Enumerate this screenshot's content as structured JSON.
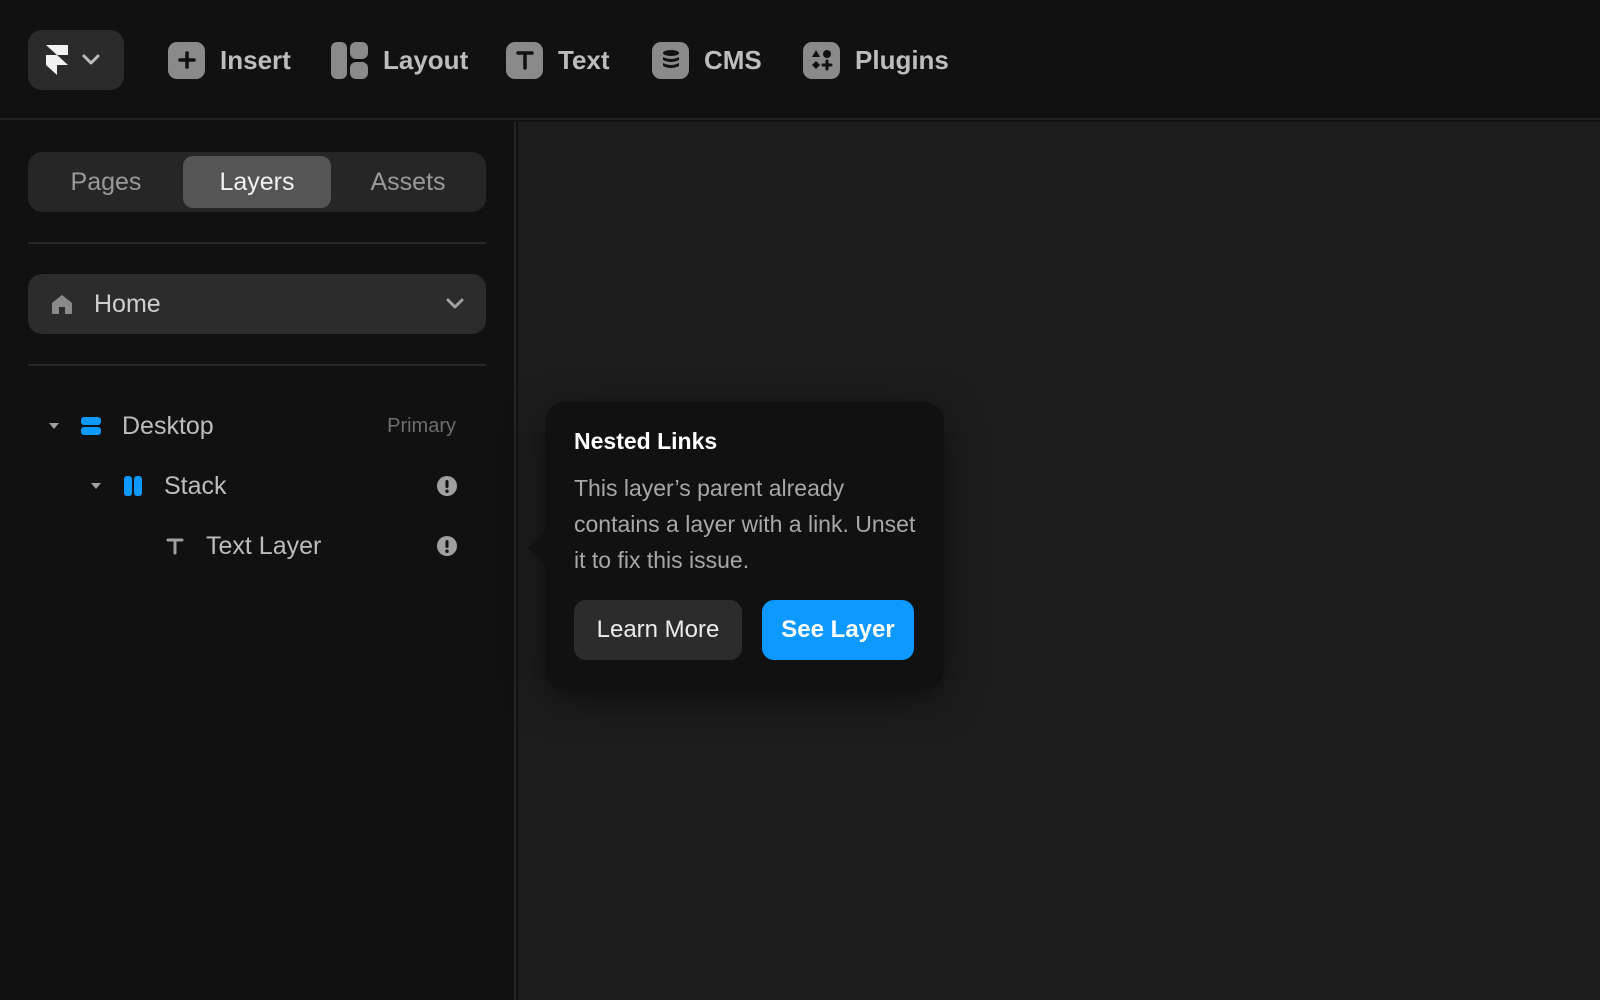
{
  "toolbar": {
    "items": [
      {
        "label": "Insert",
        "icon": "plus-icon"
      },
      {
        "label": "Layout",
        "icon": "layout-icon"
      },
      {
        "label": "Text",
        "icon": "text-icon"
      },
      {
        "label": "CMS",
        "icon": "database-icon"
      },
      {
        "label": "Plugins",
        "icon": "plugins-icon"
      }
    ]
  },
  "sidebar": {
    "tabs": [
      {
        "label": "Pages",
        "active": false
      },
      {
        "label": "Layers",
        "active": true
      },
      {
        "label": "Assets",
        "active": false
      }
    ],
    "page_selector": {
      "label": "Home",
      "icon": "home-icon"
    },
    "layers": [
      {
        "name": "Desktop",
        "tag": "Primary",
        "icon": "frame-icon",
        "expanded": true,
        "warning": false
      },
      {
        "name": "Stack",
        "tag": "",
        "icon": "stack-icon",
        "expanded": true,
        "warning": true
      },
      {
        "name": "Text Layer",
        "tag": "",
        "icon": "text-layer-icon",
        "expanded": false,
        "warning": true
      }
    ]
  },
  "popover": {
    "title": "Nested Links",
    "body": "This layer’s parent already contains a layer with a link. Unset it to fix this issue.",
    "secondary_label": "Learn More",
    "primary_label": "See Layer"
  },
  "colors": {
    "accent": "#0d99ff",
    "background": "#111111",
    "canvas": "#1d1d1d"
  }
}
